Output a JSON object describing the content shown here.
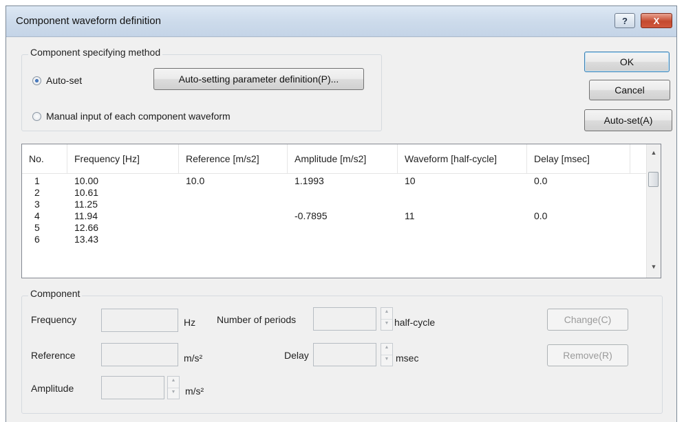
{
  "window": {
    "title": "Component waveform definition",
    "help_label": "?",
    "close_label": "X"
  },
  "method_group": {
    "legend": "Component specifying method",
    "auto_set_label": "Auto-set",
    "auto_set_checked": true,
    "auto_param_button": "Auto-setting parameter definition(P)...",
    "manual_label": "Manual input of each component waveform",
    "manual_checked": false
  },
  "right_buttons": {
    "ok": "OK",
    "cancel": "Cancel",
    "auto_set": "Auto-set(A)"
  },
  "table": {
    "columns": [
      "No.",
      "Frequency [Hz]",
      "Reference [m/s2]",
      "Amplitude [m/s2]",
      "Waveform [half-cycle]",
      "Delay [msec]"
    ],
    "rows": [
      {
        "no": "1",
        "frequency": "10.00",
        "reference": "10.0",
        "amplitude": "1.1993",
        "waveform": "10",
        "delay": "0.0"
      },
      {
        "no": "2",
        "frequency": "10.61",
        "reference": "",
        "amplitude": "",
        "waveform": "",
        "delay": ""
      },
      {
        "no": "3",
        "frequency": "11.25",
        "reference": "",
        "amplitude": "",
        "waveform": "",
        "delay": ""
      },
      {
        "no": "4",
        "frequency": "11.94",
        "reference": "",
        "amplitude": "-0.7895",
        "waveform": "11",
        "delay": "0.0"
      },
      {
        "no": "5",
        "frequency": "12.66",
        "reference": "",
        "amplitude": "",
        "waveform": "",
        "delay": ""
      },
      {
        "no": "6",
        "frequency": "13.43",
        "reference": "",
        "amplitude": "",
        "waveform": "",
        "delay": ""
      }
    ]
  },
  "component_group": {
    "legend": "Component",
    "frequency_label": "Frequency",
    "frequency_value": "",
    "frequency_unit": "Hz",
    "periods_label": "Number of periods",
    "periods_value": "",
    "periods_unit": "half-cycle",
    "reference_label": "Reference",
    "reference_value": "",
    "reference_unit": "m/s²",
    "delay_label": "Delay",
    "delay_value": "",
    "delay_unit": "msec",
    "amplitude_label": "Amplitude",
    "amplitude_value": "",
    "amplitude_unit": "m/s²",
    "change_button": "Change(C)",
    "remove_button": "Remove(R)"
  }
}
